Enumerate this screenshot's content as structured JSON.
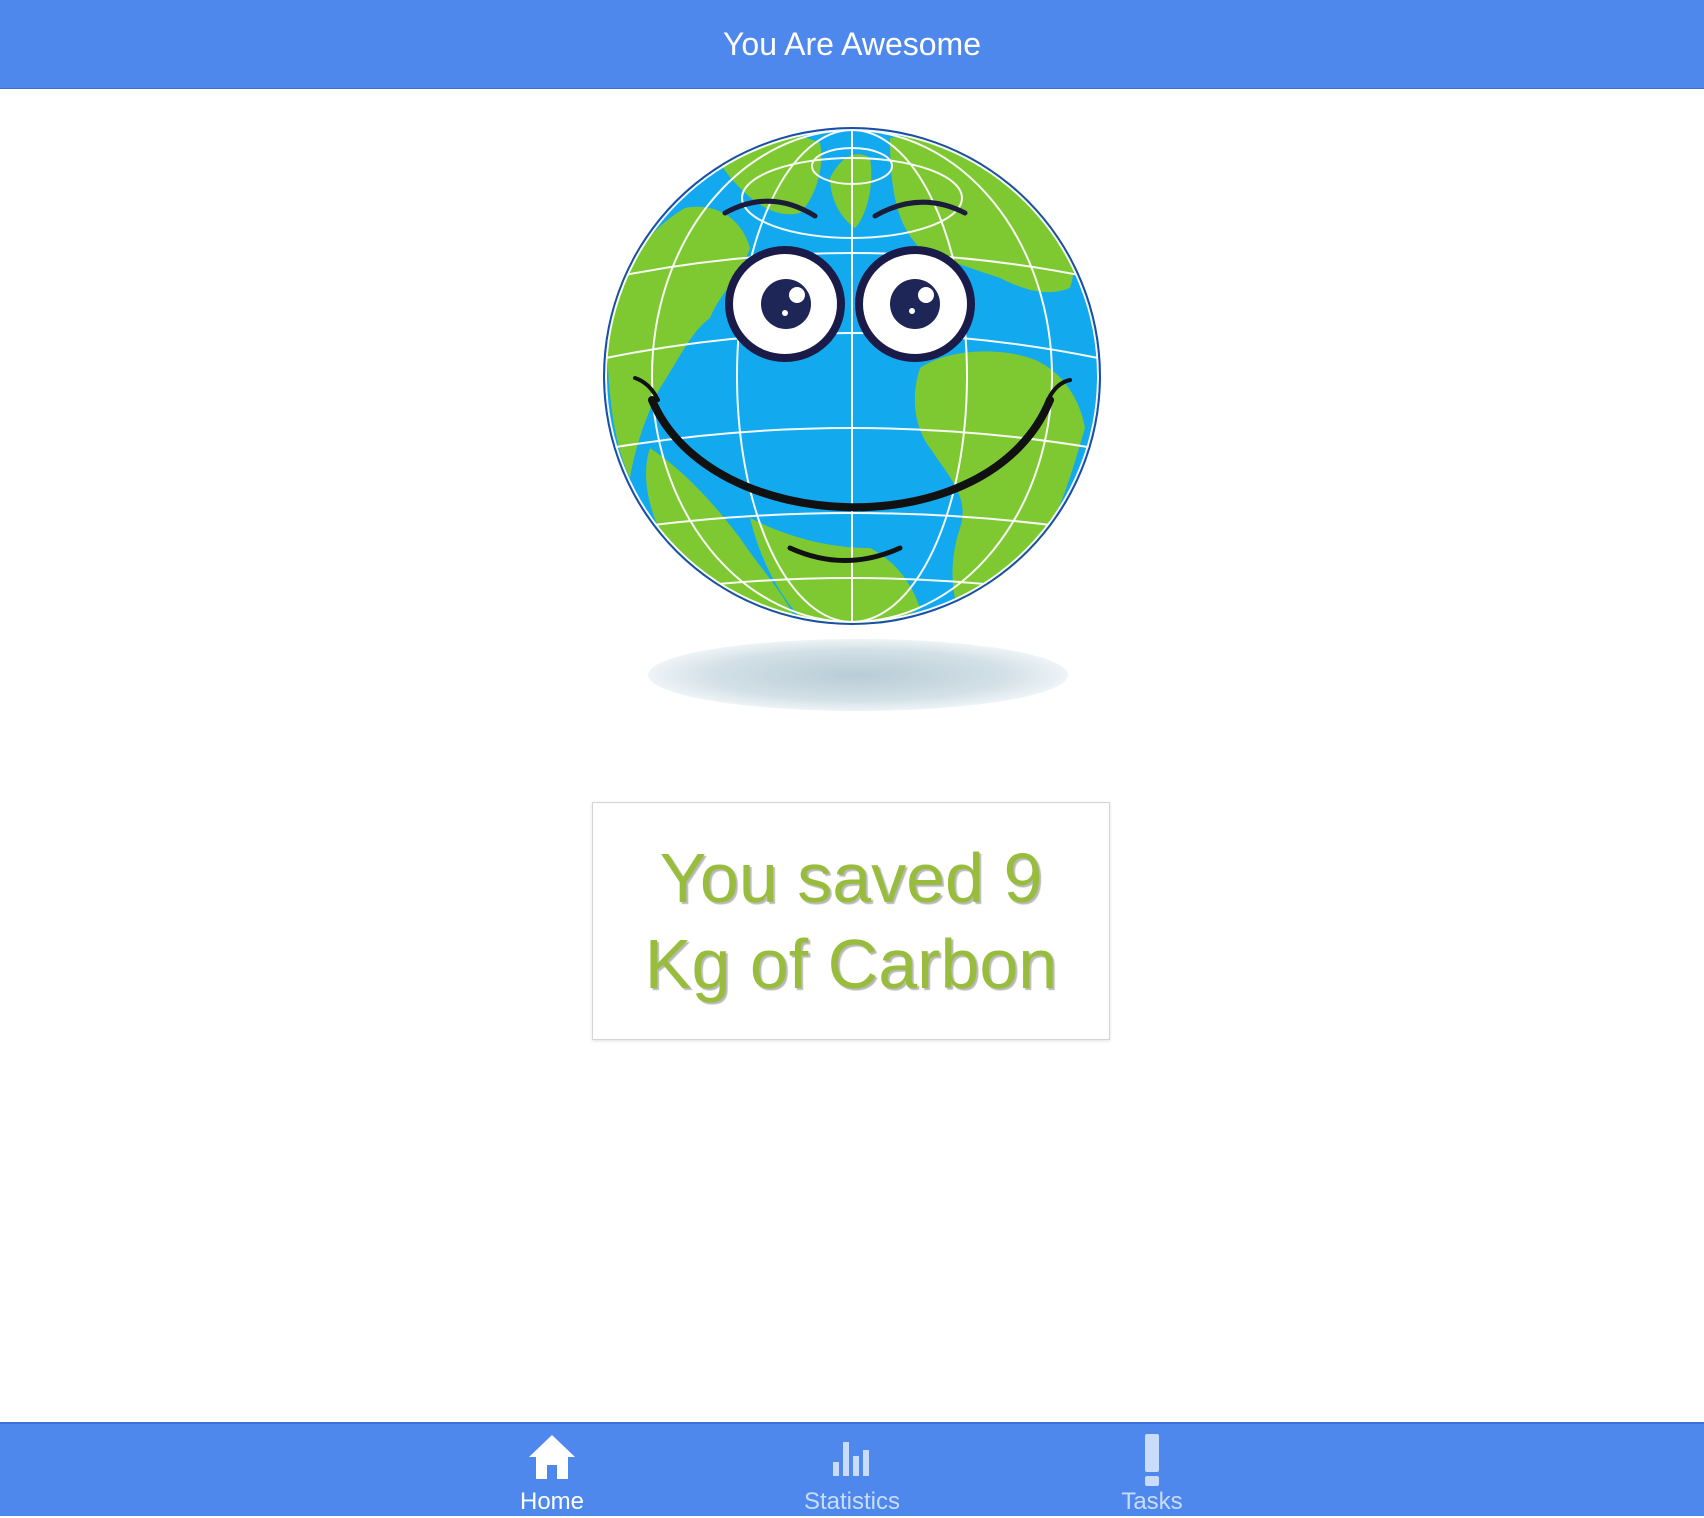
{
  "header": {
    "title": "You Are Awesome"
  },
  "message": {
    "line1": "You saved 9",
    "line2": "Kg of Carbon",
    "color": "#98bd3c"
  },
  "mascot": {
    "icon": "smiling-earth-globe"
  },
  "tabbar": {
    "background": "#4f88ec",
    "tabs": [
      {
        "label": "Home",
        "icon": "home-icon",
        "active": true
      },
      {
        "label": "Statistics",
        "icon": "bar-chart-icon",
        "active": false
      },
      {
        "label": "Tasks",
        "icon": "exclamation-icon",
        "active": false
      }
    ]
  }
}
